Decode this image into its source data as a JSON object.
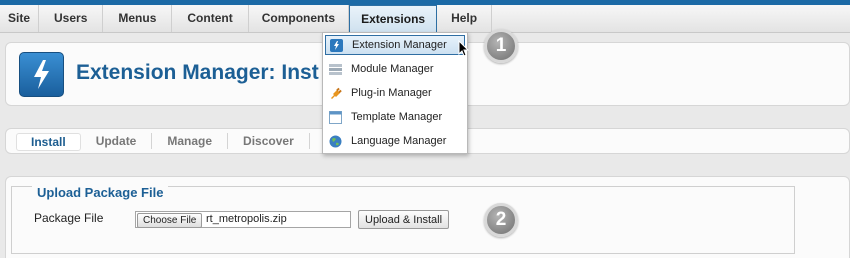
{
  "menubar": {
    "items": [
      "Site",
      "Users",
      "Menus",
      "Content",
      "Components",
      "Extensions",
      "Help"
    ],
    "active": "Extensions"
  },
  "extensions_menu": {
    "items": [
      {
        "label": "Extension Manager",
        "icon": "extension-icon"
      },
      {
        "label": "Module Manager",
        "icon": "module-icon"
      },
      {
        "label": "Plug-in Manager",
        "icon": "plugin-icon"
      },
      {
        "label": "Template Manager",
        "icon": "template-icon"
      },
      {
        "label": "Language Manager",
        "icon": "language-icon"
      }
    ]
  },
  "header": {
    "title": "Extension Manager: Inst"
  },
  "tabs": {
    "items": [
      "Install",
      "Update",
      "Manage",
      "Discover",
      ""
    ],
    "active": "Install"
  },
  "upload": {
    "legend": "Upload Package File",
    "label": "Package File",
    "choose_label": "Choose File",
    "file_name": "rt_metropolis.zip",
    "submit_label": "Upload & Install"
  },
  "callouts": [
    "1",
    "2"
  ],
  "colors": {
    "brand_blue": "#1c5f95",
    "top_stripe": "#1c6aa6",
    "badge_gray": "#7a7a7a"
  }
}
